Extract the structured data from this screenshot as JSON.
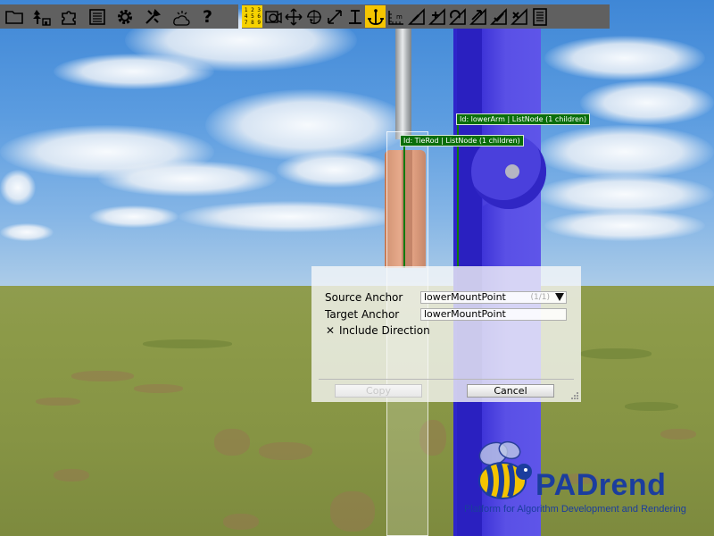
{
  "toolbar": {
    "group_left": [
      {
        "icon": "folder-icon"
      },
      {
        "icon": "scene-tree-icon"
      },
      {
        "icon": "puzzle-icon"
      },
      {
        "icon": "list-icon"
      },
      {
        "icon": "gear-icon"
      },
      {
        "icon": "tools-icon"
      },
      {
        "icon": "weather-icon"
      },
      {
        "icon": "help-icon",
        "label": "?"
      }
    ],
    "group_right": [
      {
        "icon": "layers-icon",
        "label": "1 2 3 4 5 6 7 8 9"
      },
      {
        "icon": "camera-select-icon"
      },
      {
        "icon": "move-icon"
      },
      {
        "icon": "rotate-icon"
      },
      {
        "icon": "scale-icon"
      },
      {
        "icon": "snap-icon"
      },
      {
        "icon": "anchor-icon",
        "active": true
      },
      {
        "icon": "measure-icon"
      },
      {
        "icon": "constraint-icon-1"
      },
      {
        "icon": "constraint-icon-2"
      },
      {
        "icon": "constraint-icon-3"
      },
      {
        "icon": "constraint-icon-4"
      },
      {
        "icon": "constraint-icon-5"
      },
      {
        "icon": "constraint-icon-6"
      },
      {
        "icon": "document-icon"
      }
    ]
  },
  "scene": {
    "labels": {
      "lower_arm": "Id: lowerArm | ListNode (1 children)",
      "tie_rod": "Id: TieRod | ListNode (1 children)"
    }
  },
  "dialog": {
    "source_anchor_label": "Source Anchor",
    "source_anchor_value": "lowerMountPoint",
    "source_anchor_count": "(1/1)",
    "target_anchor_label": "Target Anchor",
    "target_anchor_value": "lowerMountPoint",
    "include_direction_label": "Include Direction",
    "include_direction_checked": true,
    "checkbox_mark": "✕",
    "copy_label": "Copy",
    "cancel_label": "Cancel"
  },
  "logo": {
    "name": "PADrend",
    "tagline": "Platform for Algorithm Development and Rendering"
  },
  "colors": {
    "toolbar_bg": "#606060",
    "active_tool": "#f6c500",
    "node_label_bg": "#0a6e0a",
    "blue_object": "#3b31d6",
    "tierod": "#d98b66",
    "logo_blue": "#1b3d9e"
  }
}
